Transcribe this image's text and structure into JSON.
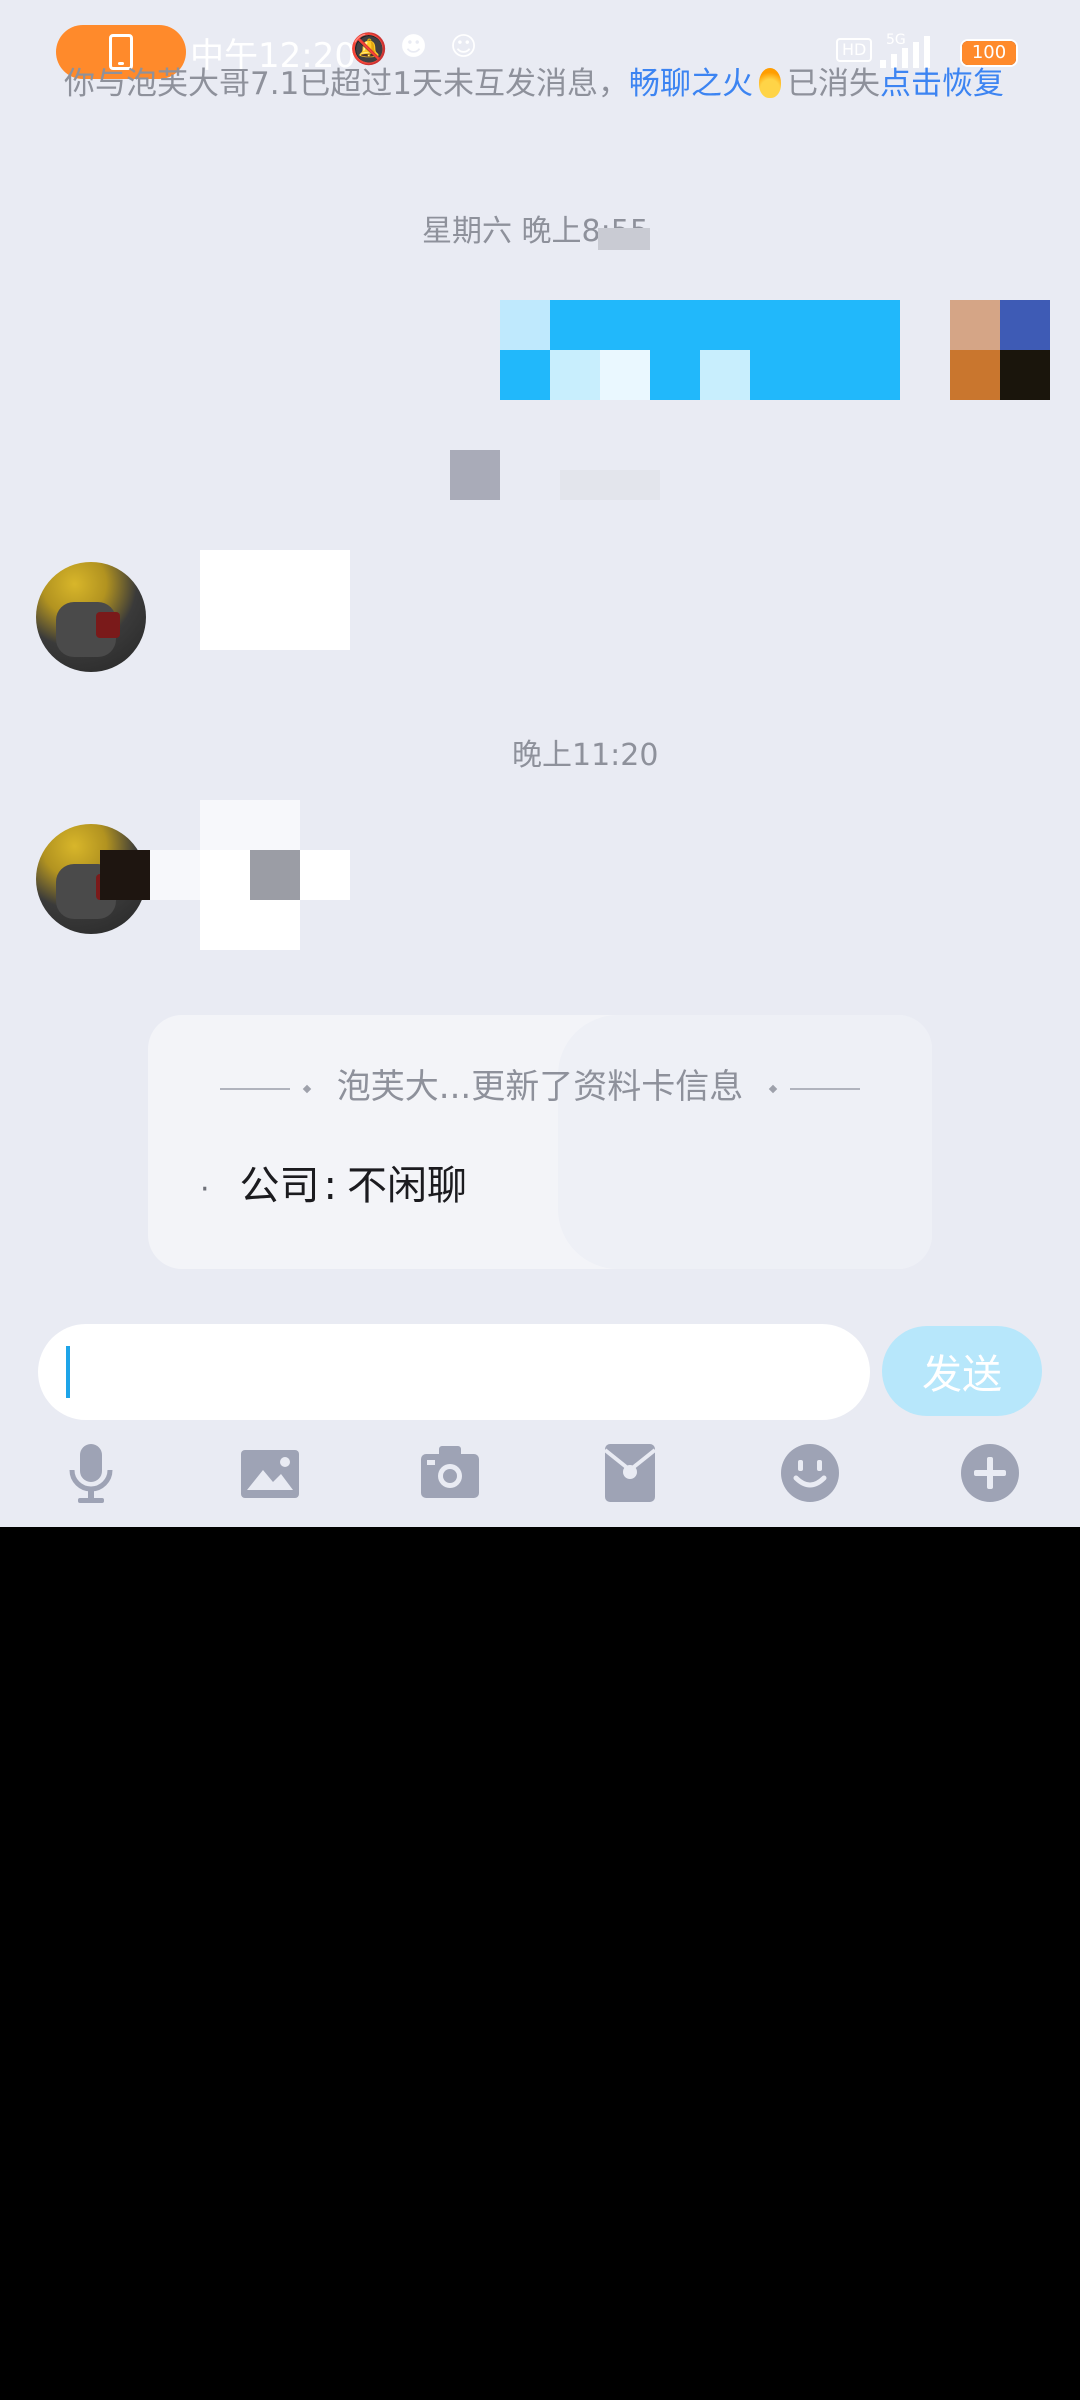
{
  "status_bar": {
    "time": "中午12:20",
    "network": "5G",
    "hd": "HD",
    "battery": "100"
  },
  "notice": {
    "prefix": "你与泡芙大哥7.1已超过1天未互发消息，",
    "streak": "畅聊之火",
    "suffix": "已消失",
    "action": "点击恢复"
  },
  "timestamps": {
    "first": "星期六 晚上8:55",
    "second": "晚上11:20"
  },
  "update_card": {
    "title": "泡芙大...更新了资料卡信息",
    "field_label": "公司",
    "separator": ":",
    "field_value": "不闲聊"
  },
  "input": {
    "placeholder": "",
    "send_label": "发送"
  },
  "toolbar": {
    "icons": [
      "microphone-icon",
      "image-icon",
      "camera-icon",
      "red-packet-icon",
      "emoji-icon",
      "plus-icon"
    ]
  },
  "colors": {
    "accent": "#3c84f2",
    "send_disabled": "#b7e7fb",
    "call_pill": "#ff8a2b",
    "background": "#e9ebf3"
  }
}
